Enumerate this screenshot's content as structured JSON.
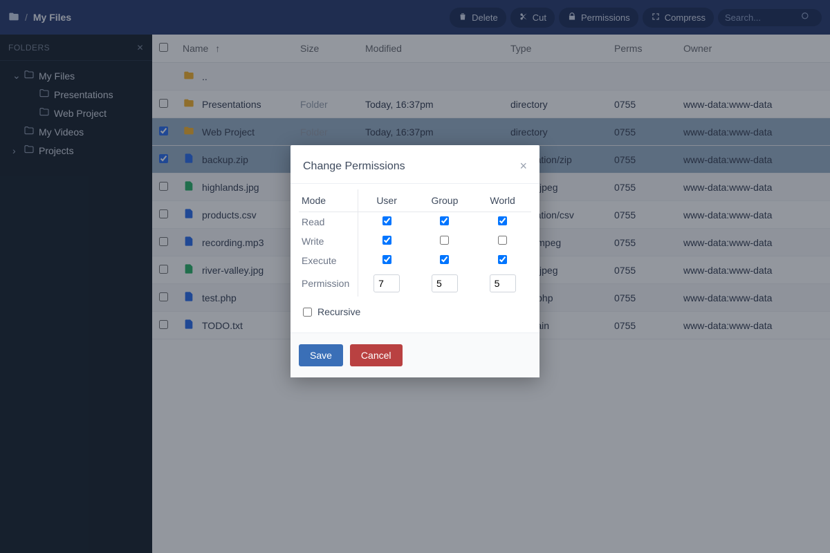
{
  "breadcrumb": {
    "root_label": "My Files"
  },
  "toolbar": {
    "delete": "Delete",
    "cut": "Cut",
    "permissions": "Permissions",
    "compress": "Compress",
    "search_placeholder": "Search..."
  },
  "sidebar": {
    "header": "FOLDERS",
    "items": [
      {
        "label": "My Files",
        "depth": 0,
        "expanded": true
      },
      {
        "label": "Presentations",
        "depth": 1
      },
      {
        "label": "Web Project",
        "depth": 1
      },
      {
        "label": "My Videos",
        "depth": 0
      },
      {
        "label": "Projects",
        "depth": 0,
        "caret": true
      }
    ]
  },
  "columns": {
    "name": "Name",
    "size": "Size",
    "modified": "Modified",
    "type": "Type",
    "perms": "Perms",
    "owner": "Owner"
  },
  "rows": [
    {
      "name": "..",
      "kind": "up"
    },
    {
      "name": "Presentations",
      "kind": "folder",
      "size": "Folder",
      "modified": "Today, 16:37pm",
      "type": "directory",
      "perms": "0755",
      "owner": "www-data:www-data"
    },
    {
      "name": "Web Project",
      "kind": "folder",
      "size": "Folder",
      "modified": "Today, 16:37pm",
      "type": "directory",
      "perms": "0755",
      "owner": "www-data:www-data",
      "selected": true
    },
    {
      "name": "backup.zip",
      "kind": "file",
      "type": "application/zip",
      "perms": "0755",
      "owner": "www-data:www-data",
      "selected": true
    },
    {
      "name": "highlands.jpg",
      "kind": "image",
      "type": "image/jpeg",
      "perms": "0755",
      "owner": "www-data:www-data"
    },
    {
      "name": "products.csv",
      "kind": "file",
      "type": "application/csv",
      "perms": "0755",
      "owner": "www-data:www-data"
    },
    {
      "name": "recording.mp3",
      "kind": "file",
      "type": "audio/mpeg",
      "perms": "0755",
      "owner": "www-data:www-data"
    },
    {
      "name": "river-valley.jpg",
      "kind": "image",
      "type": "image/jpeg",
      "perms": "0755",
      "owner": "www-data:www-data"
    },
    {
      "name": "test.php",
      "kind": "file",
      "type": "text/x-php",
      "perms": "0755",
      "owner": "www-data:www-data"
    },
    {
      "name": "TODO.txt",
      "kind": "file",
      "type": "text/plain",
      "perms": "0755",
      "owner": "www-data:www-data"
    }
  ],
  "modal": {
    "title": "Change Permissions",
    "mode": "Mode",
    "user": "User",
    "group": "Group",
    "world": "World",
    "read": "Read",
    "write": "Write",
    "execute": "Execute",
    "permission": "Permission",
    "values": {
      "user": "7",
      "group": "5",
      "world": "5"
    },
    "checks": {
      "read": {
        "user": true,
        "group": true,
        "world": true
      },
      "write": {
        "user": true,
        "group": false,
        "world": false
      },
      "execute": {
        "user": true,
        "group": true,
        "world": true
      }
    },
    "recursive": "Recursive",
    "recursive_checked": false,
    "save": "Save",
    "cancel": "Cancel"
  }
}
